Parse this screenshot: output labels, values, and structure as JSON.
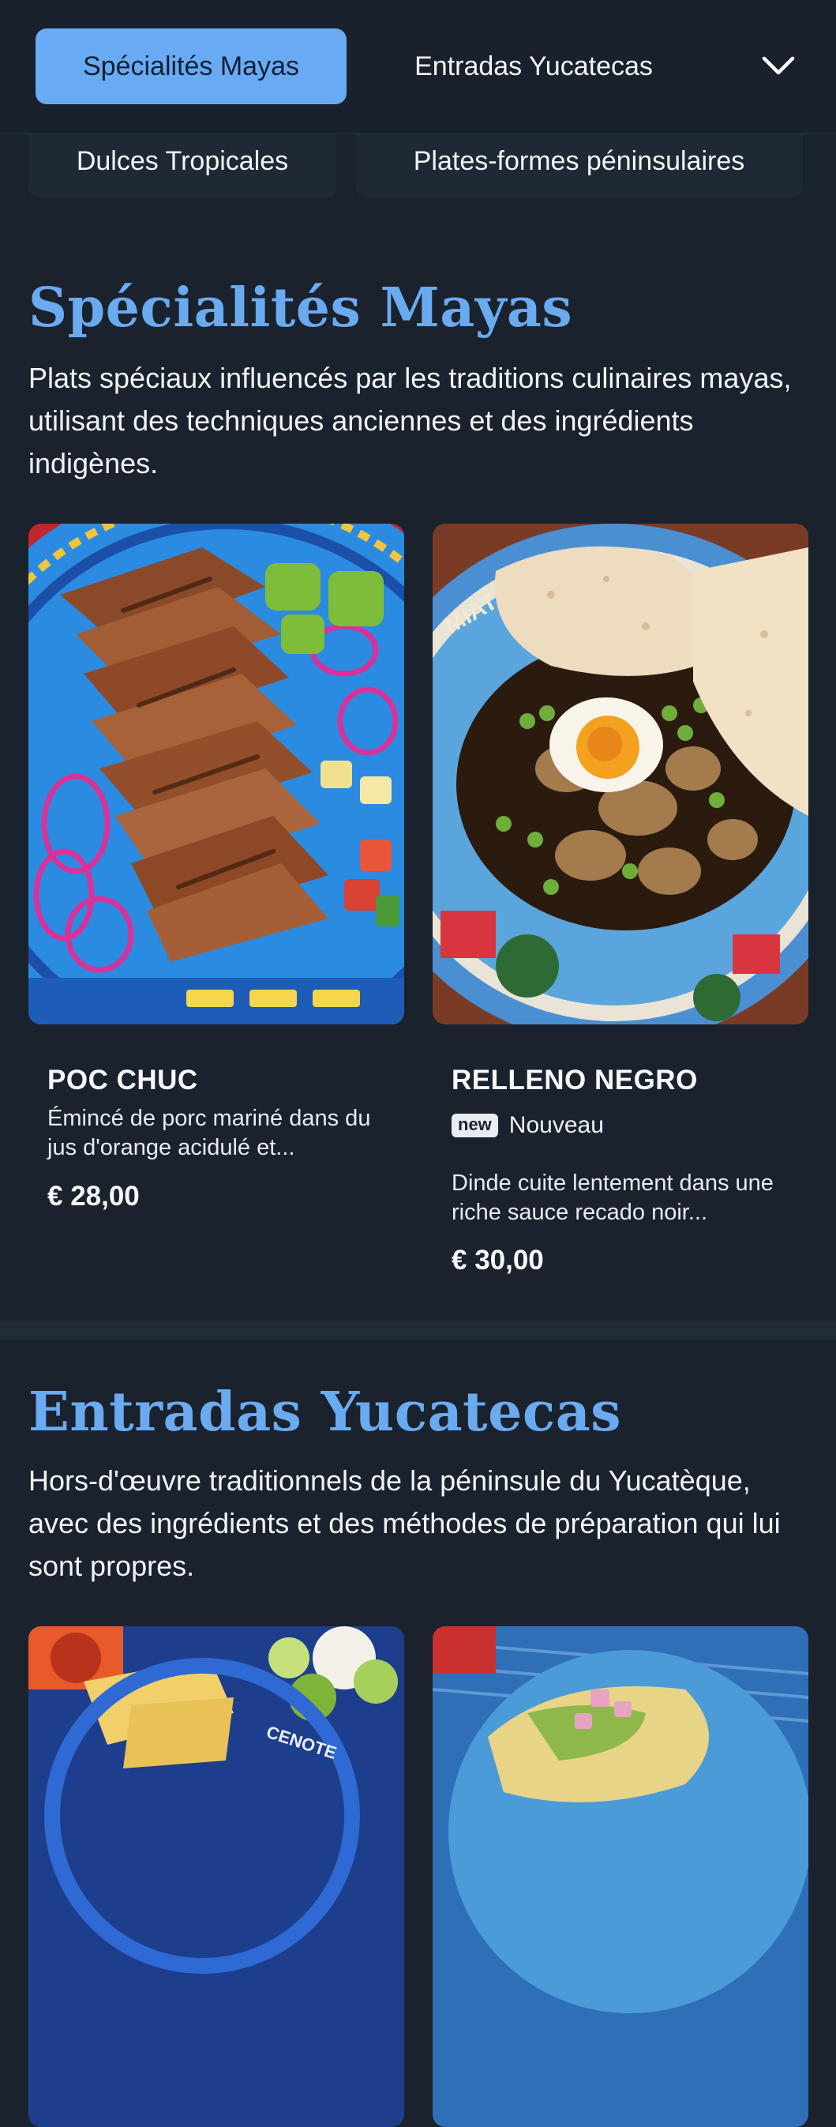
{
  "nav": {
    "tabs": [
      {
        "label": "Spécialités Mayas",
        "active": true
      },
      {
        "label": "Entradas Yucatecas",
        "active": false
      }
    ],
    "more_icon": "chevron-down-icon",
    "overflow_tabs": [
      {
        "label": "Dulces Tropicales"
      },
      {
        "label": "Plates-formes péninsulaires"
      }
    ]
  },
  "colors": {
    "accent": "#69aaf4",
    "background": "#1a222d",
    "heading": "#6aaaf0"
  },
  "sections": [
    {
      "title": "Spécialités Mayas",
      "description": "Plats spéciaux influencés par les traditions culinaires mayas, utilisant des techniques anciennes et des ingrédients indigènes.",
      "items": [
        {
          "name": "POC CHUC",
          "description": "Émincé de porc mariné dans du jus d'orange acidulé et...",
          "price": "€ 28,00"
        },
        {
          "name": "RELLENO NEGRO",
          "badge": "new",
          "badge_label": "Nouveau",
          "description": "Dinde cuite lentement dans une riche sauce recado noir...",
          "price": "€ 30,00"
        }
      ]
    },
    {
      "title": "Entradas Yucatecas",
      "description": "Hors-d'œuvre traditionnels de la péninsule du Yucatèque, avec des ingrédients et des méthodes de préparation qui lui sont propres."
    }
  ]
}
